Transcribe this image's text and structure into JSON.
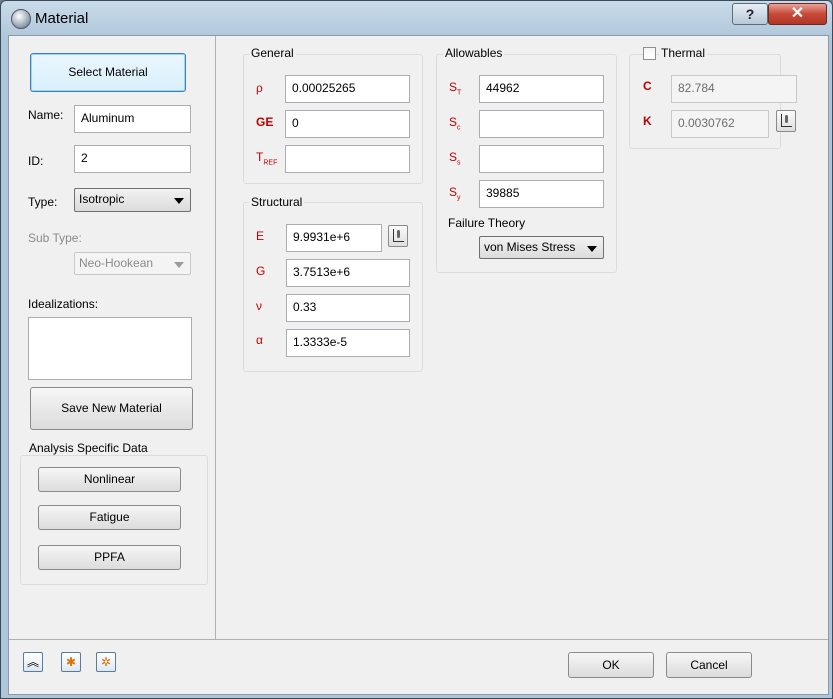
{
  "window": {
    "title": "Material",
    "help_label": "?",
    "close_label": "✕"
  },
  "left": {
    "select_material_label": "Select Material",
    "name_label": "Name:",
    "name_value": "Aluminum",
    "id_label": "ID:",
    "id_value": "2",
    "type_label": "Type:",
    "type_value": "Isotropic",
    "subtype_label": "Sub Type:",
    "subtype_value": "Neo-Hookean",
    "idealizations_label": "Idealizations:",
    "save_label": "Save New Material",
    "analysis_title": "Analysis Specific Data",
    "analysis_buttons": [
      "Nonlinear",
      "Fatigue",
      "PPFA"
    ]
  },
  "general": {
    "title": "General",
    "rho_symbol": "ρ",
    "rho_value": "0.00025265",
    "ge_symbol": "GE",
    "ge_value": "0",
    "tref_symbol": "T",
    "tref_sub": "REF",
    "tref_value": ""
  },
  "structural": {
    "title": "Structural",
    "e_symbol": "E",
    "e_value": "9.9931e+6",
    "g_symbol": "G",
    "g_value": "3.7513e+6",
    "nu_symbol": "ν",
    "nu_value": "0.33",
    "alpha_symbol": "α",
    "alpha_value": "1.3333e-5"
  },
  "allowables": {
    "title": "Allowables",
    "st_symbol": "S",
    "st_sub": "T",
    "st_value": "44962",
    "sc_symbol": "S",
    "sc_sub": "c",
    "sc_value": "",
    "ss_symbol": "S",
    "ss_sub": "s",
    "ss_value": "",
    "sy_symbol": "S",
    "sy_sub": "y",
    "sy_value": "39885",
    "failure_label": "Failure Theory",
    "failure_value": "von Mises Stress"
  },
  "thermal": {
    "title": "Thermal",
    "checked": false,
    "c_symbol": "C",
    "c_value": "82.784",
    "k_symbol": "K",
    "k_value": "0.0030762"
  },
  "footer": {
    "ok_label": "OK",
    "cancel_label": "Cancel",
    "tool_icons": [
      "collapse-icon",
      "star-icon",
      "multi-star-icon"
    ]
  },
  "colors": {
    "symbol_red": "#c00000",
    "dialog_bg": "#f0f0f0"
  }
}
